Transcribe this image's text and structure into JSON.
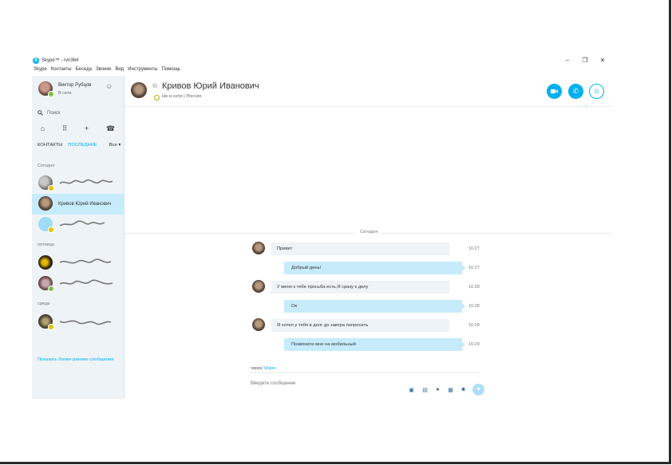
{
  "window": {
    "title": "Skype™ - rvn364",
    "controls": {
      "minimize": "–",
      "maximize": "❐",
      "close": "✕"
    }
  },
  "menu": [
    "Skype",
    "Контакты",
    "Беседа",
    "Звонки",
    "Вид",
    "Инструменты",
    "Помощь"
  ],
  "sidebar": {
    "profile": {
      "name": "Виктор Рубцов",
      "status": "В сети"
    },
    "search_placeholder": "Поиск",
    "tabs": {
      "contacts": "КОНТАКТЫ",
      "recent": "ПОСЛЕДНИЕ",
      "filter": "Все"
    },
    "groups": {
      "today": "Сегодня",
      "friday": "пятница",
      "wednesday": "среда"
    },
    "active_contact": "Кривов Юрий Иванович",
    "show_more": "Показать более ранние сообщения"
  },
  "header": {
    "contact_name": "Кривов Юрий Иванович",
    "status": "Не в сети",
    "separator": "|",
    "location": "Россия"
  },
  "conversation": {
    "divider_label": "Сегодня",
    "messages": [
      {
        "direction": "in",
        "text": "Привет",
        "time": "16:27"
      },
      {
        "direction": "out",
        "text": "Добрый день!",
        "time": "16:27"
      },
      {
        "direction": "in",
        "text": "У меня к тебе просьба есть,Я сразу к делу",
        "time": "16:28"
      },
      {
        "direction": "out",
        "text": "Ок",
        "time": "16:28"
      },
      {
        "direction": "in",
        "text": "Я хотел у тебя в долг до завтра попросить",
        "time": "16:28"
      },
      {
        "direction": "out",
        "text": "Позвоните мне на мобильный",
        "time": "16:29"
      }
    ],
    "via_prefix": "через",
    "via_service": "Skype",
    "input_placeholder": "Введите сообщение"
  },
  "colors": {
    "accent": "#00aff0",
    "active_row": "#c6ebfb",
    "sidebar_bg": "#eef3f7",
    "online": "#7cc242"
  }
}
